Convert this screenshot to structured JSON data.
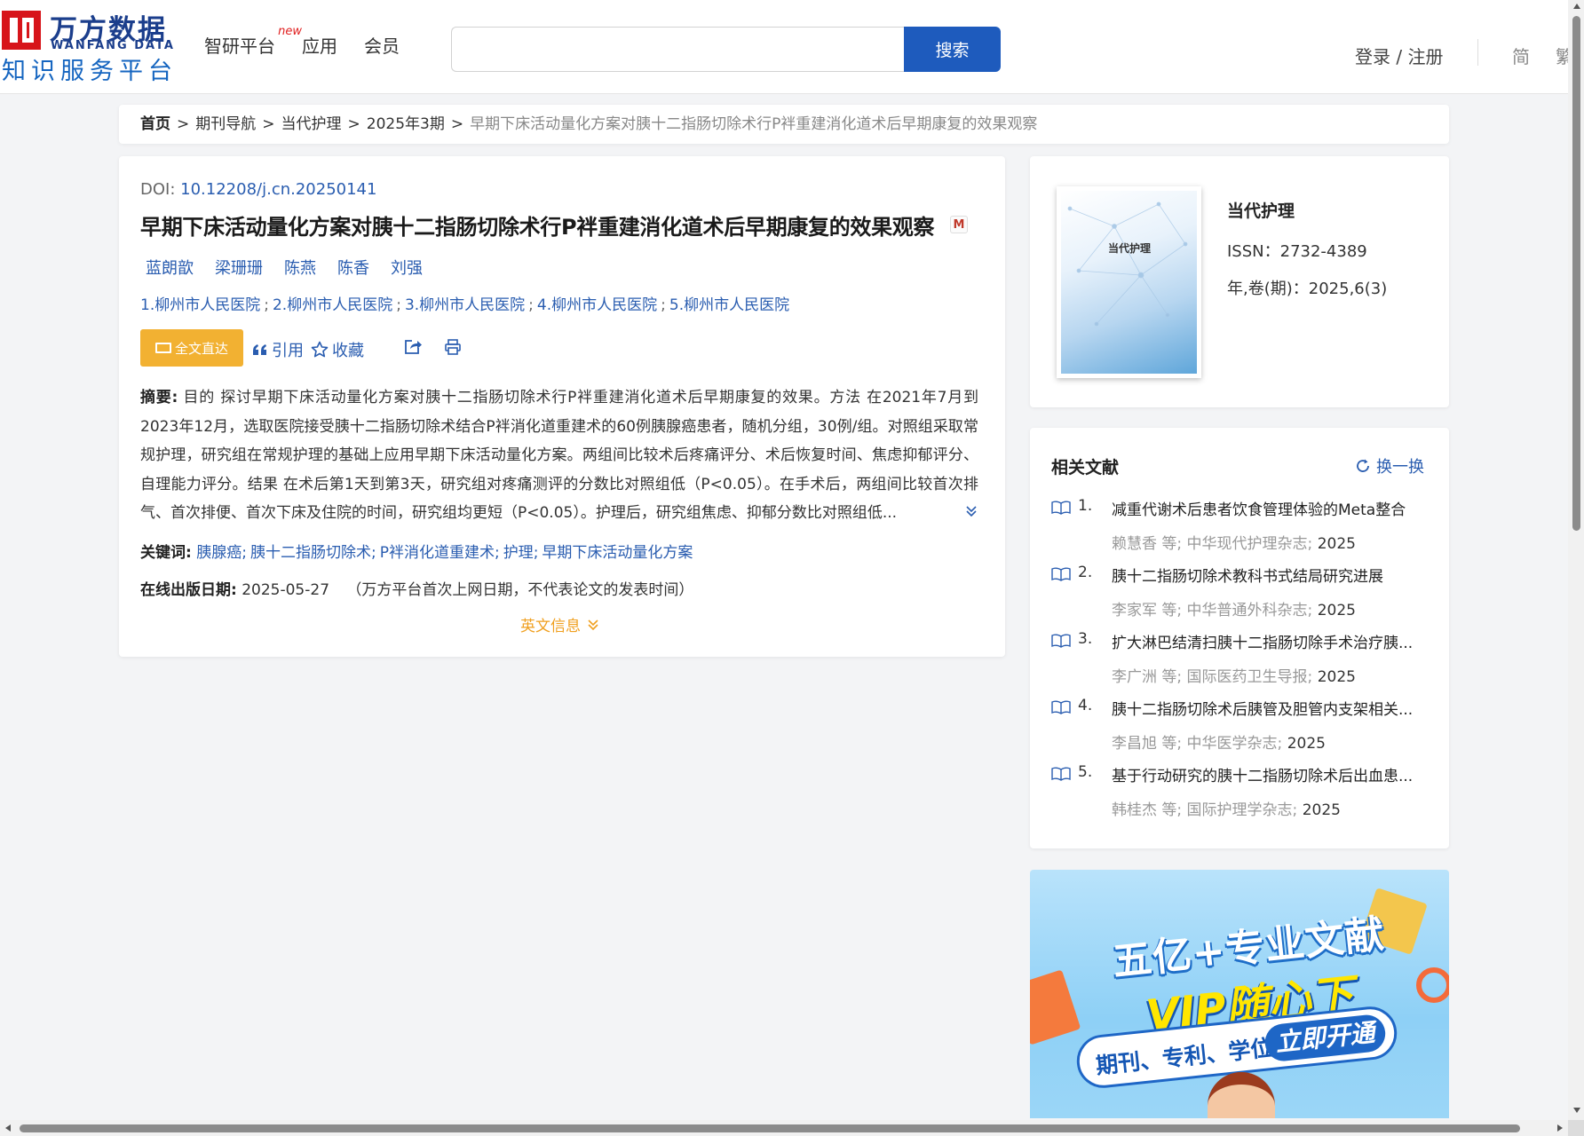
{
  "header": {
    "logo_name": "万方数据",
    "logo_en": "WANFANG DATA",
    "logo_sub": "知识服务平台",
    "nav": [
      {
        "label": "智研平台",
        "badge": "new"
      },
      {
        "label": "应用"
      },
      {
        "label": "会员"
      }
    ],
    "search": {
      "value": "",
      "placeholder": "",
      "button_label": "搜索"
    },
    "login_label": "登录 / 注册",
    "lang": [
      "简",
      "繁"
    ]
  },
  "breadcrumb": {
    "items": [
      "首页",
      "期刊导航",
      "当代护理",
      "2025年3期"
    ],
    "separator": ">",
    "current": "早期下床活动量化方案对胰十二指肠切除术行P袢重建消化道术后早期康复的效果观察"
  },
  "article": {
    "doi_label": "DOI:",
    "doi": "10.12208/j.cn.20250141",
    "title": "早期下床活动量化方案对胰十二指肠切除术行P袢重建消化道术后早期康复的效果观察",
    "badge_letter": "M",
    "authors": [
      "蓝朗歆",
      "梁珊珊",
      "陈燕",
      "陈香",
      "刘强"
    ],
    "affiliations": [
      "1.柳州市人民医院",
      "2.柳州市人民医院",
      "3.柳州市人民医院",
      "4.柳州市人民医院",
      "5.柳州市人民医院"
    ],
    "affiliation_sep": ";",
    "fulltext_label": "全文直达",
    "cite_label": "引用",
    "favorite_label": "收藏",
    "abstract_label": "摘要:",
    "abstract": "目的 探讨早期下床活动量化方案对胰十二指肠切除术行P袢重建消化道术后早期康复的效果。方法 在2021年7月到2023年12月，选取医院接受胰十二指肠切除术结合P袢消化道重建术的60例胰腺癌患者，随机分组，30例/组。对照组采取常规护理，研究组在常规护理的基础上应用早期下床活动量化方案。两组间比较术后疼痛评分、术后恢复时间、焦虑抑郁评分、自理能力评分。结果 在术后第1天到第3天，研究组对疼痛测评的分数比对照组低（P<0.05）。在手术后，两组间比较首次排气、首次排便、首次下床及住院的时间，研究组均更短（P<0.05）。护理后，研究组焦虑、抑郁分数比对照组低...",
    "keywords_label": "关键词:",
    "keywords": [
      "胰腺癌",
      "胰十二指肠切除术",
      "P袢消化道重建术",
      "护理",
      "早期下床活动量化方案"
    ],
    "keyword_sep": ";",
    "pubdate_label": "在线出版日期:",
    "pubdate": "2025-05-27",
    "pubdate_note": "（万方平台首次上网日期，不代表论文的发表时间）",
    "english_info_label": "英文信息"
  },
  "journal": {
    "cover_title": "当代护理",
    "name": "当代护理",
    "issn": "ISSN：2732-4389",
    "volume": "年,卷(期)：2025,6(3)"
  },
  "related": {
    "title": "相关文献",
    "refresh_label": "换一换",
    "items": [
      {
        "num": "1.",
        "title": "减重代谢术后患者饮食管理体验的Meta整合",
        "author": "赖慧香",
        "etal": "等;",
        "journal": "中华现代护理杂志",
        "sep": ";",
        "year": "2025"
      },
      {
        "num": "2.",
        "title": "胰十二指肠切除术教科书式结局研究进展",
        "author": "李家军",
        "etal": "等;",
        "journal": "中华普通外科杂志",
        "sep": ";",
        "year": "2025"
      },
      {
        "num": "3.",
        "title": "扩大淋巴结清扫胰十二指肠切除手术治疗胰...",
        "author": "李广洲",
        "etal": "等;",
        "journal": "国际医药卫生导报",
        "sep": ";",
        "year": "2025"
      },
      {
        "num": "4.",
        "title": "胰十二指肠切除术后胰管及胆管内支架相关...",
        "author": "李昌旭",
        "etal": "等;",
        "journal": "中华医学杂志",
        "sep": ";",
        "year": "2025"
      },
      {
        "num": "5.",
        "title": "基于行动研究的胰十二指肠切除术后出血患...",
        "author": "韩桂杰",
        "etal": "等;",
        "journal": "国际护理学杂志",
        "sep": ";",
        "year": "2025"
      }
    ]
  },
  "ad": {
    "line1": "五亿+专业文献",
    "line2": "VIP随心下",
    "line3": "期刊、专利、学位",
    "cta": "立即开通"
  },
  "colors": {
    "brand_red": "#d7141a",
    "brand_blue": "#1e5bbd",
    "link_blue": "#2a5db0",
    "fulltext_orange": "#f2b132",
    "english_info_orange": "#f0a020"
  }
}
